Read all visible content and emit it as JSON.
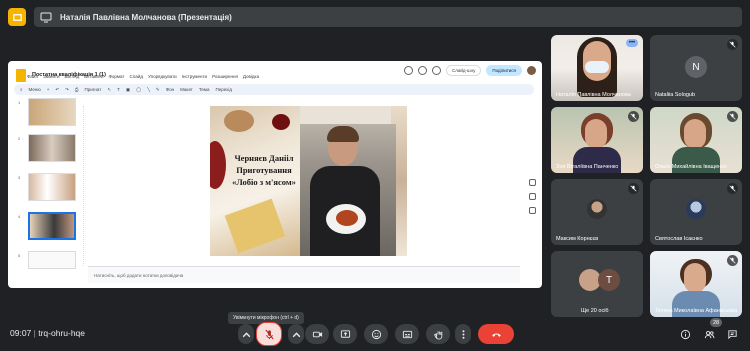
{
  "presentation_bar": {
    "presenter_label": "Наталія Павлівна Молчанова (Презентація)"
  },
  "doc": {
    "title": "Постатна кваліфікація 1 (1)",
    "menu": [
      "Файл",
      "Змінити",
      "Вигляд",
      "Вставити",
      "Формат",
      "Слайд",
      "Упорядкувати",
      "Інструменти",
      "Розширення",
      "Довідка"
    ],
    "slideshow_button": "Слайд-шоу",
    "share_button": "Поділитися",
    "toolbar": {
      "menu_label": "Меню",
      "zoom": "Пригнат",
      "background": "Фон",
      "layout": "Макет",
      "theme": "Тема",
      "transition": "Перехід"
    },
    "slide_numbers": [
      "1",
      "2",
      "3",
      "4",
      "5"
    ],
    "slide_text": [
      "Черняєв Данііл",
      "Приготування",
      "«Лобіо з м'ясом»"
    ],
    "notes_placeholder": "Натисніть, щоб додати нотатки доповідача"
  },
  "participants": [
    {
      "name": "Наталія Павлівна Молчанова"
    },
    {
      "name": "Nataliia Sologub",
      "initial": "N"
    },
    {
      "name": "Зоя Віталіївна Панченко"
    },
    {
      "name": "Ольга Михайлівна Іващенко"
    },
    {
      "name": "Максим Корнєєв"
    },
    {
      "name": "Святослав Ісаєнко"
    },
    {
      "name": "Ще 20 осіб",
      "initial": "T"
    },
    {
      "name": "Тетяна Миколаївна Афанасьєва"
    }
  ],
  "meeting": {
    "time": "09:07",
    "code": "trq-ohru-hqe",
    "mic_tooltip": "Увімкнути мікрофон (ctrl + d)",
    "people_count": "28"
  },
  "colors": {
    "background": "#202124",
    "end_call": "#ea4335",
    "mic_off_active": "#f9dedc",
    "accent": "#8ab4f8"
  }
}
